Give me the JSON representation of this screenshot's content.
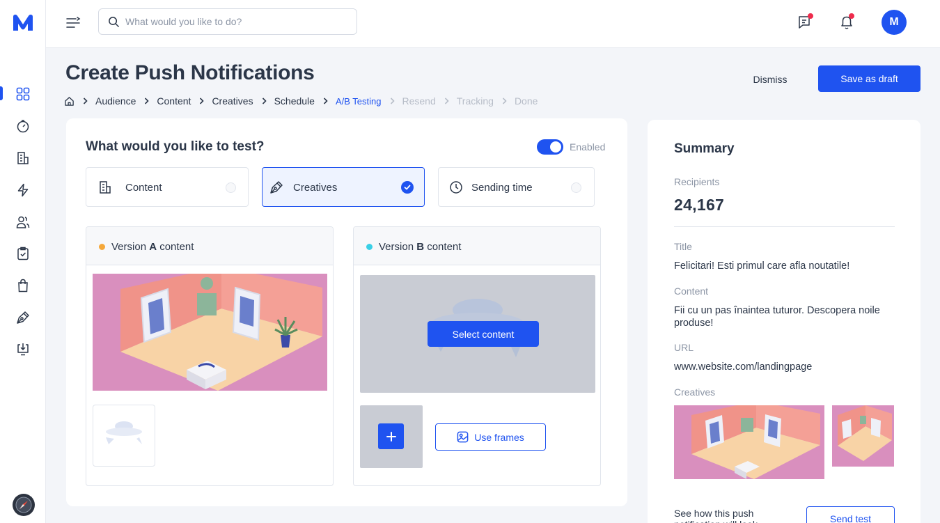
{
  "app": {
    "logo_letter": "M",
    "user_initial": "M"
  },
  "search": {
    "placeholder": "What would you like to do?"
  },
  "sidebar": {
    "items": [
      {
        "name": "dashboard",
        "icon": "grid-icon",
        "active": true
      },
      {
        "name": "analytics",
        "icon": "gauge-icon"
      },
      {
        "name": "reports",
        "icon": "document-chart-icon"
      },
      {
        "name": "automations",
        "icon": "lightning-icon"
      },
      {
        "name": "audience",
        "icon": "users-icon"
      },
      {
        "name": "tasks",
        "icon": "clipboard-check-icon"
      },
      {
        "name": "shop",
        "icon": "bag-icon"
      },
      {
        "name": "creatives",
        "icon": "pen-tool-icon"
      },
      {
        "name": "downloads",
        "icon": "download-icon"
      }
    ],
    "bottom_icon": "compass-icon"
  },
  "header": {
    "title": "Create Push Notifications",
    "dismiss_label": "Dismiss",
    "save_label": "Save as draft"
  },
  "breadcrumb": {
    "home_icon": "home-icon",
    "steps": [
      {
        "label": "Audience",
        "state": "done"
      },
      {
        "label": "Content",
        "state": "done"
      },
      {
        "label": "Creatives",
        "state": "done"
      },
      {
        "label": "Schedule",
        "state": "done"
      },
      {
        "label": "A/B Testing",
        "state": "active"
      },
      {
        "label": "Resend",
        "state": "todo"
      },
      {
        "label": "Tracking",
        "state": "todo"
      },
      {
        "label": "Done",
        "state": "todo"
      }
    ]
  },
  "test": {
    "title": "What would you like to test?",
    "toggle_label": "Enabled",
    "toggle_on": true,
    "options": [
      {
        "label": "Content",
        "icon": "document-icon",
        "selected": false
      },
      {
        "label": "Creatives",
        "icon": "pen-tool-icon",
        "selected": true
      },
      {
        "label": "Sending time",
        "icon": "clock-icon",
        "selected": false
      }
    ]
  },
  "versions": {
    "a": {
      "prefix": "Version ",
      "letter": "A",
      "suffix": " content",
      "dot_color": "#f5a83a"
    },
    "b": {
      "prefix": "Version ",
      "letter": "B",
      "suffix": " content",
      "dot_color": "#3ad0e6",
      "select_label": "Select content",
      "use_frames_label": "Use frames"
    }
  },
  "summary": {
    "title": "Summary",
    "recipients_label": "Recipients",
    "recipients_value": "24,167",
    "title_label": "Title",
    "title_value": "Felicitari! Esti primul care afla noutatile!",
    "content_label": "Content",
    "content_value": "Fii cu un pas înaintea tuturor. Descopera noile produse!",
    "url_label": "URL",
    "url_value": "www.website.com/landingpage",
    "creatives_label": "Creatives",
    "foot_text": "See how this push notification will look",
    "send_test_label": "Send test"
  },
  "colors": {
    "primary": "#1f53f0",
    "text": "#2b3648",
    "muted": "#8d96a6",
    "notification_dot": "#ee2b4c",
    "scene_pink": "#d98fbe",
    "scene_floor": "#f8d3a6"
  }
}
